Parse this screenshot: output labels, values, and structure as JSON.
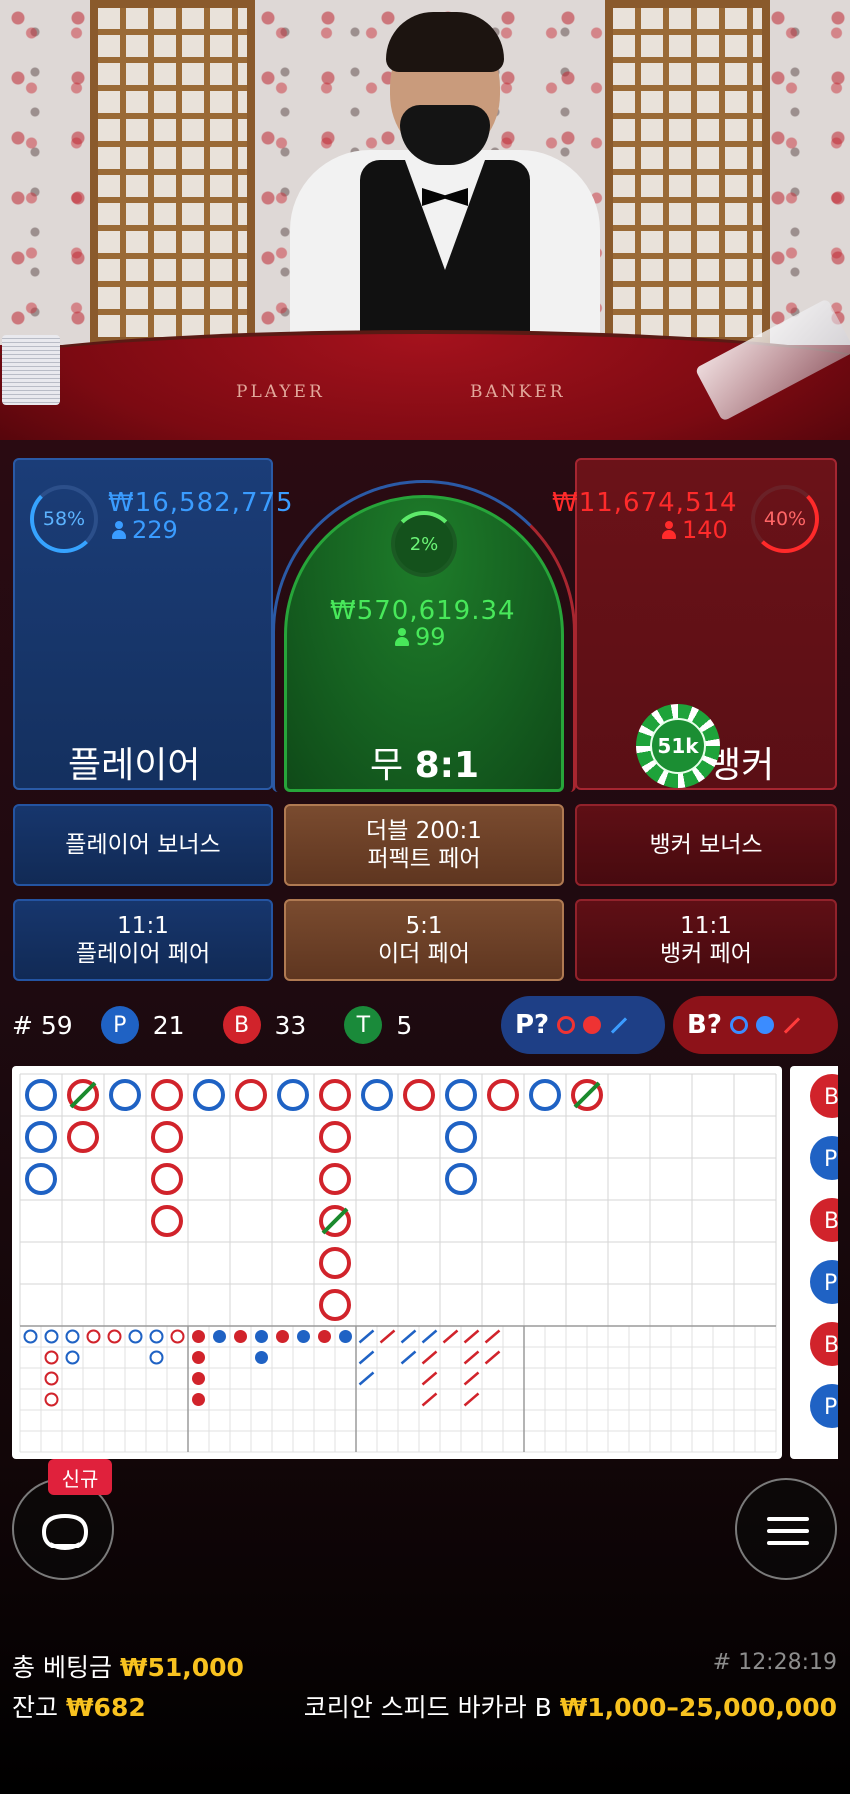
{
  "player": {
    "label": "플레이어",
    "percent": "58%",
    "amount": "₩16,582,775",
    "count": "229"
  },
  "tie": {
    "label": "무",
    "odds": "8:1",
    "percent": "2%",
    "amount": "₩570,619.34",
    "count": "99"
  },
  "banker": {
    "label": "뱅커",
    "percent": "40%",
    "amount": "₩11,674,514",
    "count": "140",
    "chip": "51k"
  },
  "side_bets": {
    "player_bonus": "플레이어 보너스",
    "double_perfect_line1": "더블 200:1",
    "double_perfect_line2": "퍼펙트 페어",
    "banker_bonus": "뱅커 보너스",
    "player_pair_odds": "11:1",
    "player_pair_label": "플레이어 페어",
    "either_pair_odds": "5:1",
    "either_pair_label": "이더 페어",
    "banker_pair_odds": "11:1",
    "banker_pair_label": "뱅커 페어"
  },
  "stats": {
    "round_prefix": "#",
    "round": "59",
    "p_letter": "P",
    "p_count": "21",
    "b_letter": "B",
    "b_count": "33",
    "t_letter": "T",
    "t_count": "5"
  },
  "predict": {
    "player": "P?",
    "banker": "B?"
  },
  "road": {
    "big_road": [
      [
        "P",
        "T",
        "P",
        "B",
        "P",
        "B",
        "P",
        "B",
        "P",
        "B",
        "P",
        "B",
        "P",
        "T"
      ],
      [
        "P",
        "B",
        "",
        "B",
        "",
        "",
        "",
        "B",
        "",
        "",
        "P",
        "",
        "",
        ""
      ],
      [
        "P",
        "",
        "",
        "B",
        "",
        "",
        "",
        "B",
        "",
        "",
        "P",
        "",
        "",
        ""
      ],
      [
        "",
        "",
        "",
        "B",
        "",
        "",
        "",
        "T",
        "",
        "",
        "",
        "",
        "",
        ""
      ],
      [
        "",
        "",
        "",
        "",
        "",
        "",
        "",
        "B",
        "",
        "",
        "",
        "",
        "",
        ""
      ],
      [
        "",
        "",
        "",
        "",
        "",
        "",
        "",
        "B",
        "",
        "",
        "",
        "",
        "",
        ""
      ]
    ],
    "side_bead": [
      "B",
      "P",
      "B",
      "P",
      "B",
      "P"
    ]
  },
  "footer": {
    "total_bet_label": "총 베팅금",
    "total_bet": "₩51,000",
    "balance_label": "잔고",
    "balance": "₩682",
    "time": "# 12:28:19",
    "table_name": "코리안 스피드 바카라 B",
    "limits": "₩1,000–25,000,000",
    "new_badge": "신규"
  },
  "colors": {
    "player": "#1f62c4",
    "banker": "#d1232b",
    "tie": "#1a8a2d",
    "gold": "#f8c21f"
  },
  "icons": {
    "chat": "chat-bubble-icon",
    "menu": "hamburger-menu-icon",
    "person": "person-icon"
  }
}
